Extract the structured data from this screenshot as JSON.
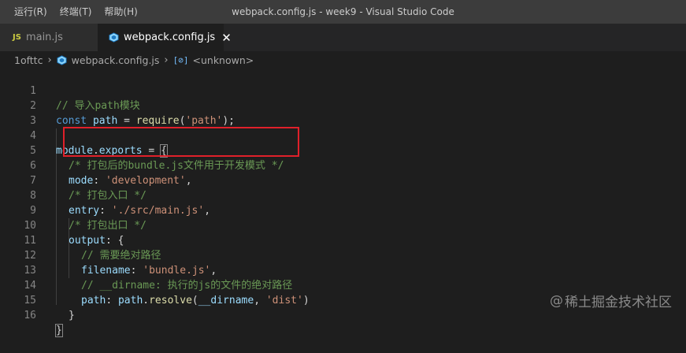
{
  "menu": {
    "items": [
      {
        "label": "运行(R)"
      },
      {
        "label": "终端(T)"
      },
      {
        "label": "帮助(H)"
      }
    ]
  },
  "window_title": "webpack.config.js - week9 - Visual Studio Code",
  "tabs": [
    {
      "icon_text": "JS",
      "label": "main.js",
      "active": false
    },
    {
      "label": "webpack.config.js",
      "active": true,
      "close": "✕"
    }
  ],
  "breadcrumb": {
    "folder": "1ofttc",
    "file": "webpack.config.js",
    "symbol_icon": "[⊘]",
    "symbol": "<unknown>"
  },
  "lines": {
    "n1": "1",
    "n2": "2",
    "n3": "3",
    "n4": "4",
    "n5": "5",
    "n6": "6",
    "n7": "7",
    "n8": "8",
    "n9": "9",
    "n10": "10",
    "n11": "11",
    "n12": "12",
    "n13": "13",
    "n14": "14",
    "n15": "15",
    "n16": "16",
    "l1_comment": "// 导入path模块",
    "l2_const": "const",
    "l2_var": "path",
    "l2_eq": " = ",
    "l2_fn": "require",
    "l2_open": "(",
    "l2_str": "'path'",
    "l2_close": ");",
    "l4_obj": "module",
    "l4_dot": ".",
    "l4_prop": "exports",
    "l4_eq": " = ",
    "l4_brace": "{",
    "l5_comment": "/* 打包后的bundle.js文件用于开发模式 */",
    "l6_key": "mode",
    "l6_colon": ": ",
    "l6_str": "'development'",
    "l6_comma": ",",
    "l7_comment": "/* 打包入口 */",
    "l8_key": "entry",
    "l8_colon": ": ",
    "l8_str": "'./src/main.js'",
    "l8_comma": ",",
    "l9_comment": "/* 打包出口 */",
    "l10_key": "output",
    "l10_colon": ": ",
    "l10_brace": "{",
    "l11_comment": "// 需要绝对路径",
    "l12_key": "filename",
    "l12_colon": ": ",
    "l12_str": "'bundle.js'",
    "l12_comma": ",",
    "l13_comment": "// __dirname: 执行的js的文件的绝对路径",
    "l14_key": "path",
    "l14_colon": ": ",
    "l14_obj": "path",
    "l14_dot": ".",
    "l14_fn": "resolve",
    "l14_open": "(",
    "l14_arg": "__dirname",
    "l14_sep": ", ",
    "l14_str": "'dist'",
    "l14_close": ")",
    "l15_brace": "}",
    "l16_brace": "}"
  },
  "watermark": {
    "text": "稀土掘金技术社区",
    "at": "@"
  },
  "colors": {
    "highlight_box": "#e0202a",
    "comment": "#6a9955",
    "keyword": "#569cd6",
    "string": "#ce9178",
    "function": "#dcdcaa",
    "variable": "#9cdcfe"
  }
}
